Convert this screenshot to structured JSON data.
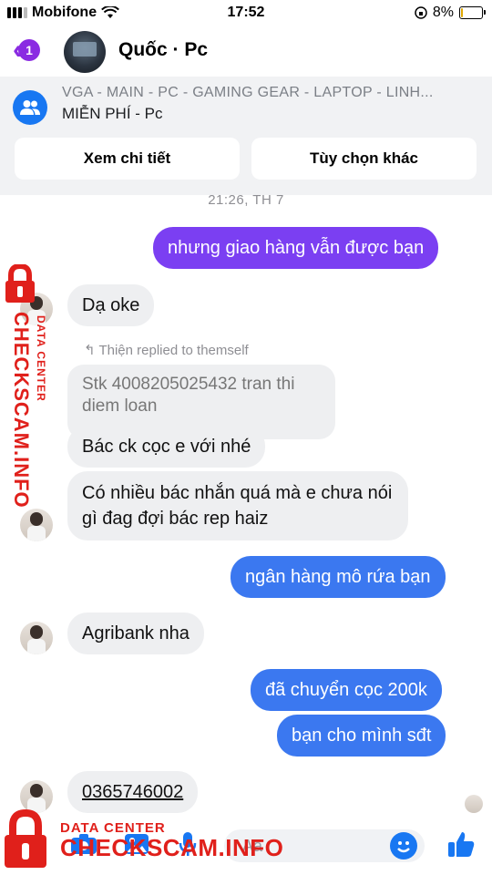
{
  "status_bar": {
    "carrier": "Mobifone",
    "time": "17:52",
    "battery": "8%"
  },
  "header": {
    "unread_count": "1",
    "title": "Quốc · Pc"
  },
  "group": {
    "name": "VGA - MAIN - PC - GAMING GEAR - LAPTOP - LINH...",
    "subtitle": "MIỄN PHÍ - Pc",
    "buttons": [
      "Xem chi tiết",
      "Tùy chọn khác"
    ]
  },
  "chat": {
    "timestamp": "21:26, TH 7",
    "reply_note": "Thiện replied to themself",
    "messages": [
      {
        "side": "out",
        "text": "nhưng giao hàng vẫn được bạn"
      },
      {
        "side": "in",
        "text": "Dạ oke"
      },
      {
        "side": "in",
        "text": "Stk 4008205025432 tran thi diem loan"
      },
      {
        "side": "in",
        "text": "Bác ck cọc e với nhé"
      },
      {
        "side": "in",
        "text": "Có nhiều bác nhắn quá mà e chưa nói gì đag đợi bác rep haiz"
      },
      {
        "side": "out",
        "text": "ngân hàng mô rứa bạn"
      },
      {
        "side": "in",
        "text": "Agribank nha"
      },
      {
        "side": "out",
        "text": "đã chuyển cọc 200k"
      },
      {
        "side": "out",
        "text": "bạn cho mình sđt"
      },
      {
        "side": "in",
        "text": "0365746002"
      }
    ]
  },
  "composer": {
    "placeholder": "Aa"
  },
  "watermark": {
    "label": "DATA CENTER",
    "site": "CHECKSCAM.INFO"
  },
  "colors": {
    "accent_purple": "#7b3ff2",
    "accent_blue": "#3b78f0",
    "messenger_blue": "#1877f2",
    "watermark_red": "#e0201b"
  }
}
